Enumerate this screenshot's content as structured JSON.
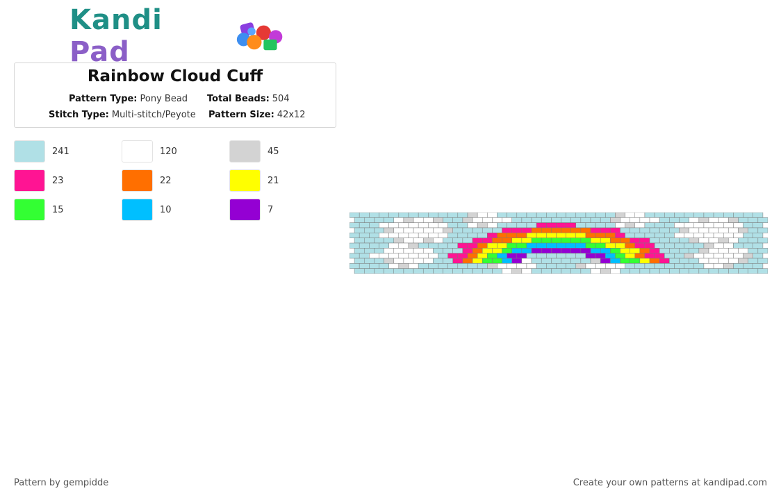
{
  "logo": {
    "part1": "Kandi",
    "part2": "Pad"
  },
  "pattern": {
    "title": "Rainbow Cloud Cuff",
    "type_label": "Pattern Type:",
    "type_value": "Pony Bead",
    "beads_label": "Total Beads:",
    "beads_value": "504",
    "stitch_label": "Stitch Type:",
    "stitch_value": "Multi-stitch/Peyote",
    "size_label": "Pattern Size:",
    "size_value": "42x12",
    "columns": 42,
    "rows": 12
  },
  "colors": [
    {
      "hex": "#b0e0e6",
      "count": "241"
    },
    {
      "hex": "#ffffff",
      "count": "120"
    },
    {
      "hex": "#d3d3d3",
      "count": "45"
    },
    {
      "hex": "#ff1493",
      "count": "23"
    },
    {
      "hex": "#ff6f00",
      "count": "22"
    },
    {
      "hex": "#ffff00",
      "count": "21"
    },
    {
      "hex": "#33ff33",
      "count": "15"
    },
    {
      "hex": "#00bfff",
      "count": "10"
    },
    {
      "hex": "#9400d3",
      "count": "7"
    }
  ],
  "footer": {
    "left": "Pattern by gempidde",
    "right": "Create your own patterns at kandipad.com"
  }
}
